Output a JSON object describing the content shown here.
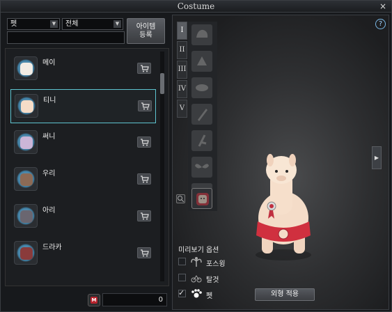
{
  "window": {
    "title": "Costume",
    "close_glyph": "×"
  },
  "filters": {
    "category_select": "펫",
    "scope_select": "전체",
    "search_value": "",
    "register_button": {
      "line1": "아이템",
      "line2": "등록"
    }
  },
  "pet_list": [
    {
      "name": "메이",
      "face_color": "#f2ece4",
      "selected": false
    },
    {
      "name": "티니",
      "face_color": "#f6ddc8",
      "selected": true
    },
    {
      "name": "써니",
      "face_color": "#cbb6d8",
      "selected": false
    },
    {
      "name": "우리",
      "face_color": "#8c6a55",
      "selected": false
    },
    {
      "name": "아리",
      "face_color": "#6a6670",
      "selected": false
    },
    {
      "name": "드라카",
      "face_color": "#8a3b3b",
      "selected": false
    }
  ],
  "currency": {
    "icon_letter": "M",
    "amount": "0"
  },
  "right_panel": {
    "help_glyph": "?",
    "slot_tabs": [
      "I",
      "II",
      "III",
      "IV",
      "V"
    ],
    "active_tab": "I",
    "expand_glyph": "▶",
    "preview_options": {
      "title": "미리보기 옵션",
      "items": [
        {
          "label": "포스윙",
          "checked": false,
          "icon": "wing-icon"
        },
        {
          "label": "탈것",
          "checked": false,
          "icon": "mount-icon"
        },
        {
          "label": "펫",
          "checked": true,
          "icon": "paw-icon"
        }
      ]
    },
    "apply_button": "외형 적용"
  },
  "colors": {
    "accent_selected_border": "#5ec4d0",
    "currency_red": "#b8232d",
    "help_blue": "#7ab8e6"
  }
}
